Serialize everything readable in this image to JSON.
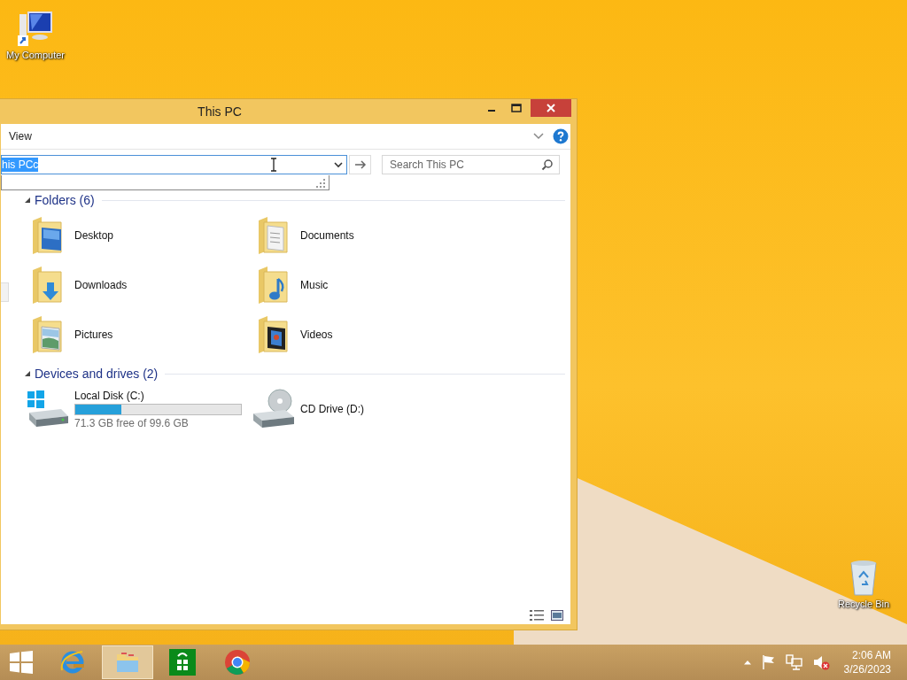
{
  "desktop_icons": [
    {
      "kind": "computer",
      "label": "My Computer"
    },
    {
      "kind": "recycle-bin",
      "label": "Recycle Bin"
    }
  ],
  "window": {
    "title": "This PC",
    "ribbon_tab": "View",
    "address": {
      "value": "his PCc"
    },
    "search": {
      "placeholder": "Search This PC"
    },
    "groups": [
      {
        "title": "Folders (6)",
        "expanded": true,
        "items": [
          {
            "kind": "desktop",
            "label": "Desktop"
          },
          {
            "kind": "documents",
            "label": "Documents"
          },
          {
            "kind": "downloads",
            "label": "Downloads"
          },
          {
            "kind": "music",
            "label": "Music"
          },
          {
            "kind": "pictures",
            "label": "Pictures"
          },
          {
            "kind": "videos",
            "label": "Videos"
          }
        ]
      },
      {
        "title": "Devices and drives (2)",
        "expanded": true,
        "items": [
          {
            "kind": "disk",
            "label": "Local Disk (C:)",
            "level": 0.28,
            "detail": "71.3 GB free of 99.6 GB"
          },
          {
            "kind": "cd",
            "label": "CD Drive (D:)"
          }
        ]
      }
    ]
  },
  "taskbar": {
    "apps": [
      {
        "kind": "ie",
        "selected": false
      },
      {
        "kind": "explorer",
        "selected": true
      },
      {
        "kind": "store",
        "selected": false
      },
      {
        "kind": "chrome",
        "selected": false
      }
    ],
    "time": "2:06 AM",
    "date": "3/26/2023"
  }
}
